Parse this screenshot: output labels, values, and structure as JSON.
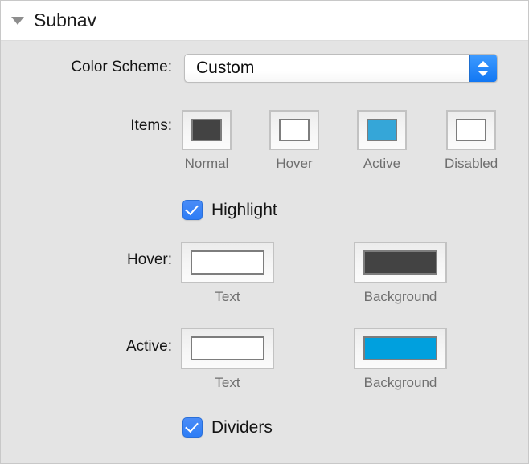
{
  "section": {
    "title": "Subnav",
    "expanded": true,
    "disclosure_icon": "triangle-down-icon"
  },
  "color_scheme": {
    "label": "Color Scheme:",
    "value": "Custom",
    "stepper_up_icon": "chevron-up-icon",
    "stepper_down_icon": "chevron-down-icon"
  },
  "items": {
    "label": "Items:",
    "swatches": [
      {
        "caption": "Normal",
        "color": "#434343"
      },
      {
        "caption": "Hover",
        "color": "#ffffff"
      },
      {
        "caption": "Active",
        "color": "#35a6d8"
      },
      {
        "caption": "Disabled",
        "color": "#ffffff"
      }
    ]
  },
  "highlight": {
    "label": "Highlight",
    "checked": true,
    "accent": "#2d7df6"
  },
  "hover": {
    "label": "Hover:",
    "swatches": [
      {
        "caption": "Text",
        "color": "#ffffff"
      },
      {
        "caption": "Background",
        "color": "#434343"
      }
    ]
  },
  "active": {
    "label": "Active:",
    "swatches": [
      {
        "caption": "Text",
        "color": "#ffffff"
      },
      {
        "caption": "Background",
        "color": "#00a0de"
      }
    ]
  },
  "dividers": {
    "label": "Dividers",
    "checked": true,
    "accent": "#2d7df6"
  },
  "theme": {
    "panel_background": "#e4e4e4",
    "header_background": "#ffffff",
    "label_color": "#141414",
    "caption_color": "#6e6e6e"
  }
}
